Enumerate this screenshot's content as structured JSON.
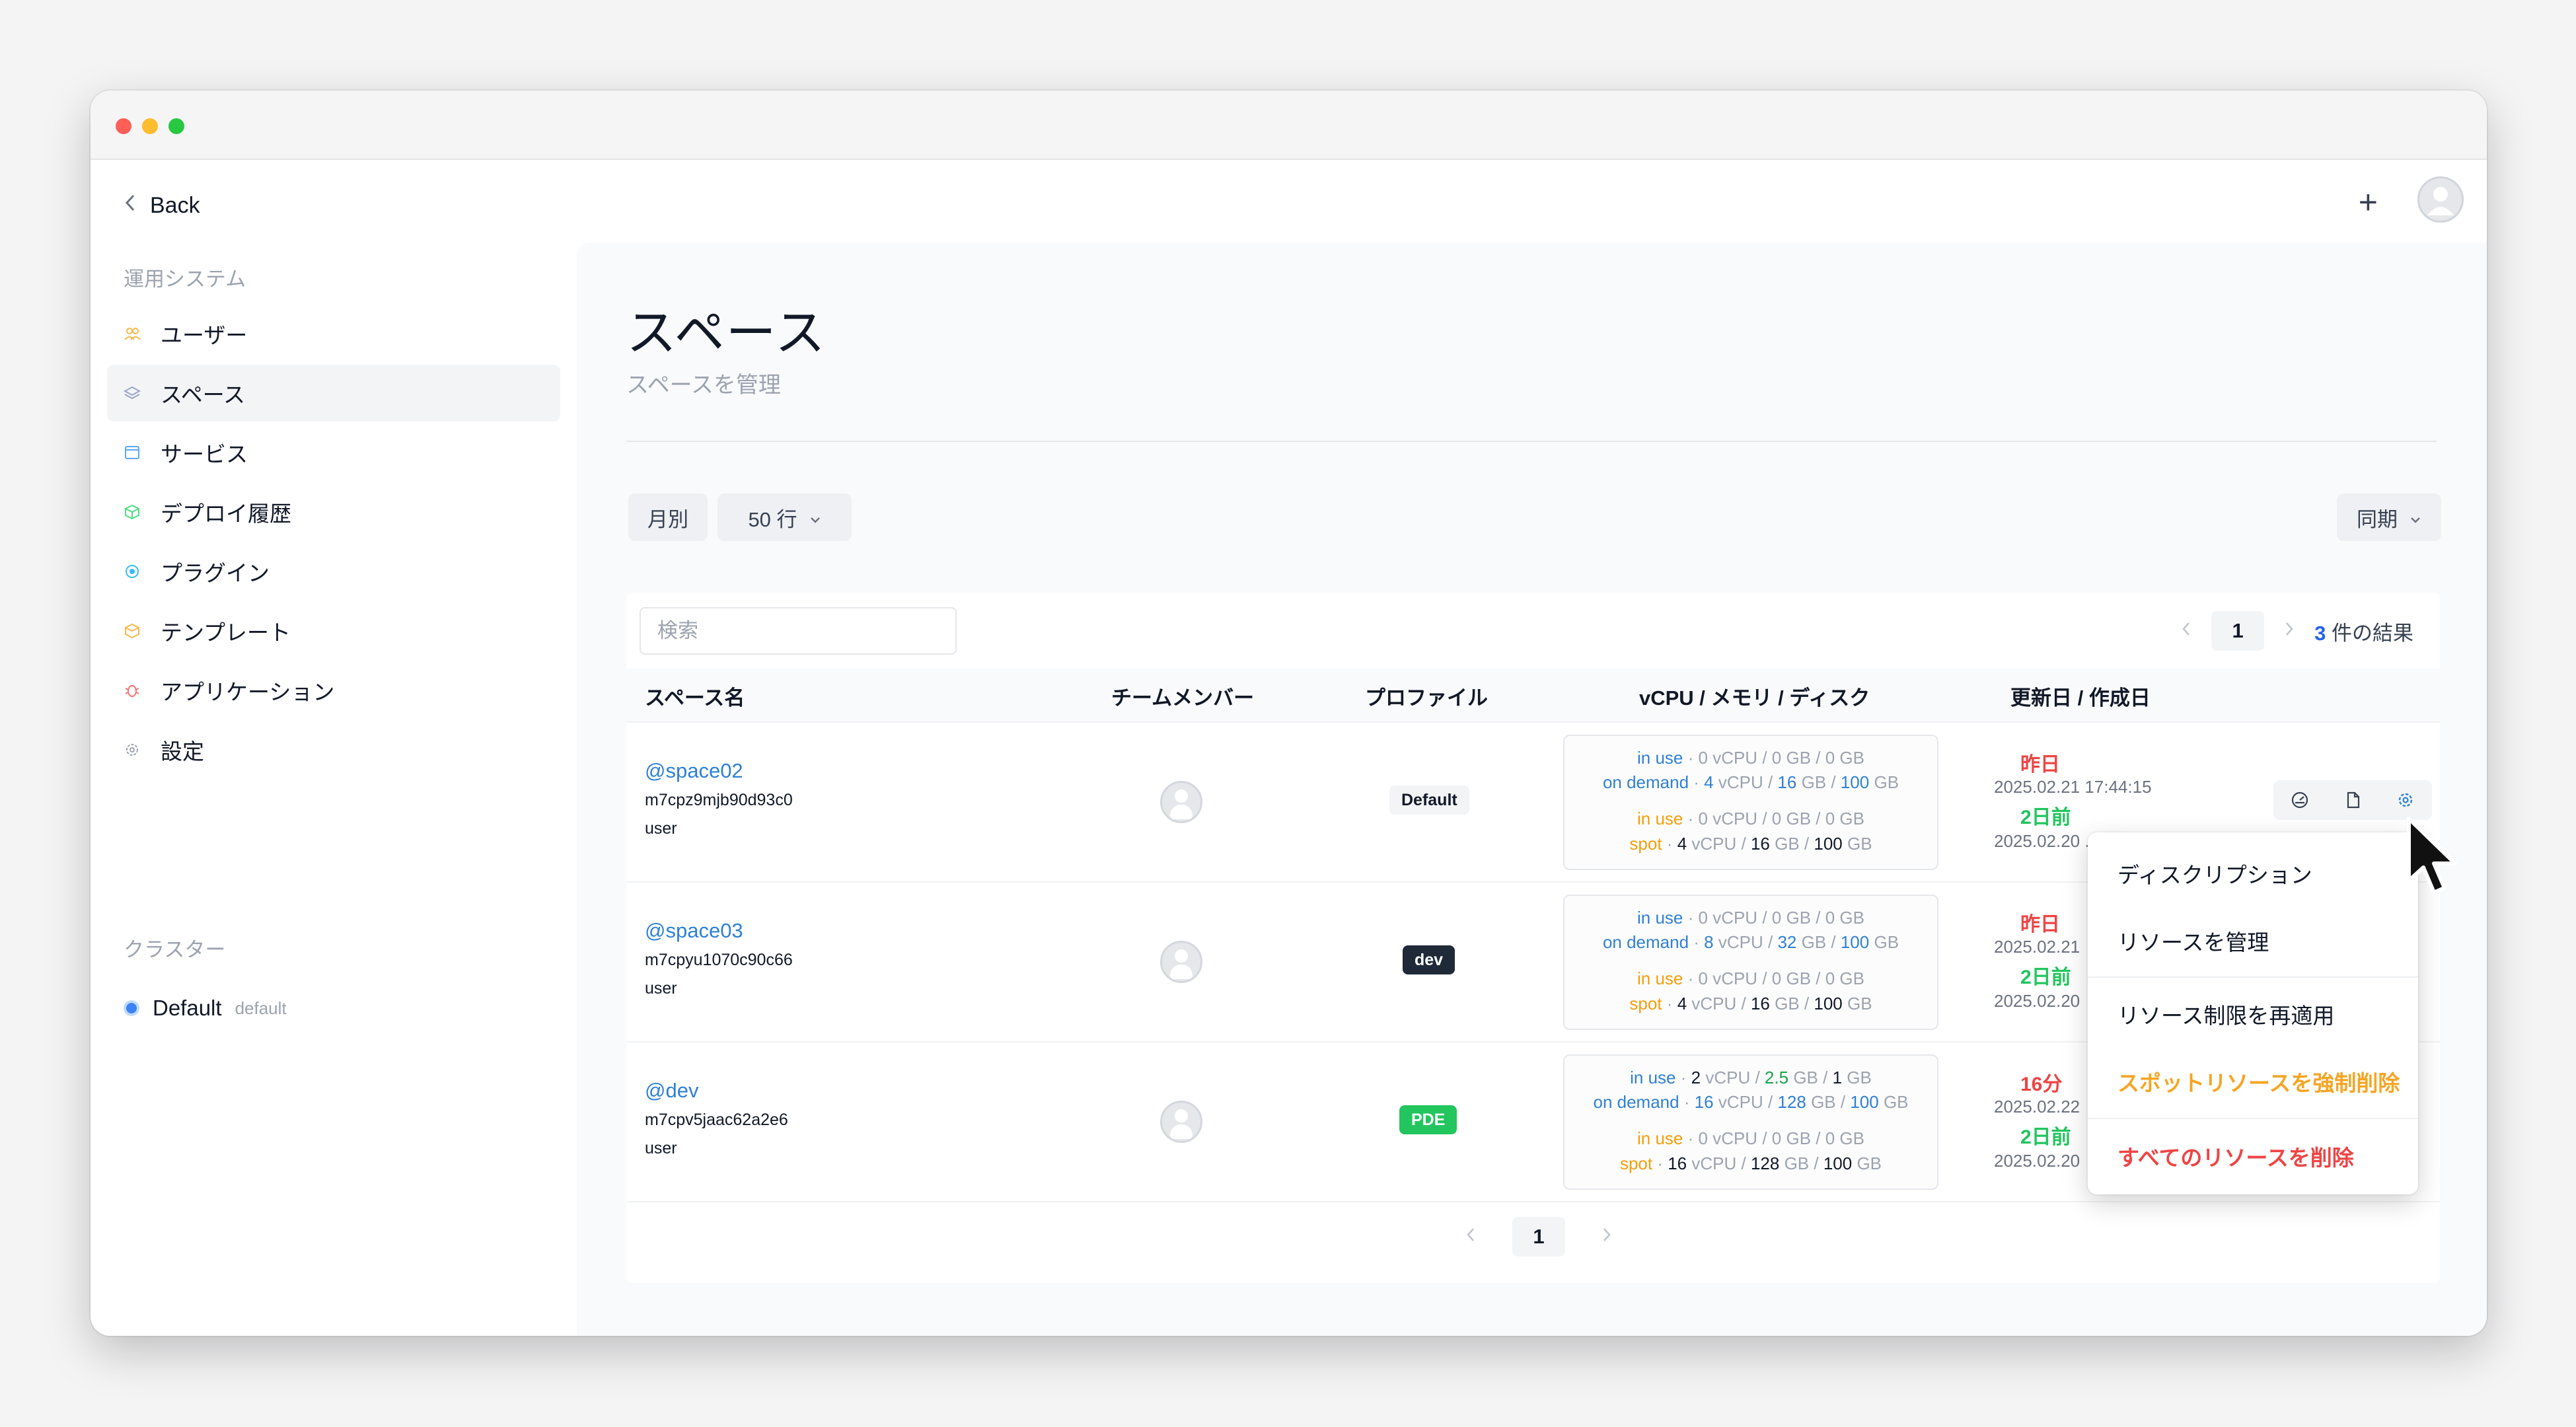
{
  "sidebar": {
    "back_label": "Back",
    "section_system": "運用システム",
    "items": [
      {
        "label": "ユーザー",
        "icon": "users-icon"
      },
      {
        "label": "スペース",
        "icon": "layers-icon"
      },
      {
        "label": "サービス",
        "icon": "window-icon"
      },
      {
        "label": "デプロイ履歴",
        "icon": "cube-icon"
      },
      {
        "label": "プラグイン",
        "icon": "plugin-icon"
      },
      {
        "label": "テンプレート",
        "icon": "box-icon"
      },
      {
        "label": "アプリケーション",
        "icon": "bug-icon"
      },
      {
        "label": "設定",
        "icon": "gear-icon"
      }
    ],
    "section_cluster": "クラスター",
    "cluster": {
      "name": "Default",
      "sub": "default"
    }
  },
  "header": {
    "plus_label": "+"
  },
  "page": {
    "title": "スペース",
    "subtitle": "スペースを管理"
  },
  "filters": {
    "monthly": "月別",
    "rows": "50 行",
    "sync": "同期"
  },
  "table": {
    "search_placeholder": "検索",
    "current_page": "1",
    "result_count": "3",
    "result_suffix": "件の結果",
    "headers": {
      "name": "スペース名",
      "members": "チームメンバー",
      "profile": "プロファイル",
      "resources": "vCPU / メモリ / ディスク",
      "dates": "更新日 / 作成日"
    },
    "rows": [
      {
        "name": "@space02",
        "id": "m7cpz9mjb90d93c0",
        "user": "user",
        "profile": "Default",
        "ondemand_inuse": {
          "label": "in use",
          "vcpu": "0",
          "mem": "0",
          "disk": "0"
        },
        "ondemand": {
          "label": "on demand",
          "vcpu": "4",
          "mem": "16",
          "disk": "100"
        },
        "spot_inuse": {
          "label": "in use",
          "vcpu": "0",
          "mem": "0",
          "disk": "0"
        },
        "spot": {
          "label": "spot",
          "vcpu": "4",
          "mem": "16",
          "disk": "100"
        },
        "updated_rel": "昨日",
        "updated_abs": "2025.02.21 17:44:15",
        "created_rel": "2日前",
        "created_abs": "2025.02.20 ..."
      },
      {
        "name": "@space03",
        "id": "m7cpyu1070c90c66",
        "user": "user",
        "profile": "dev",
        "ondemand_inuse": {
          "label": "in use",
          "vcpu": "0",
          "mem": "0",
          "disk": "0"
        },
        "ondemand": {
          "label": "on demand",
          "vcpu": "8",
          "mem": "32",
          "disk": "100"
        },
        "spot_inuse": {
          "label": "in use",
          "vcpu": "0",
          "mem": "0",
          "disk": "0"
        },
        "spot": {
          "label": "spot",
          "vcpu": "4",
          "mem": "16",
          "disk": "100"
        },
        "updated_rel": "昨日",
        "updated_abs": "2025.02.21",
        "created_rel": "2日前",
        "created_abs": "2025.02.20"
      },
      {
        "name": "@dev",
        "id": "m7cpv5jaac62a2e6",
        "user": "user",
        "profile": "PDE",
        "ondemand_inuse": {
          "label": "in use",
          "vcpu": "2",
          "mem": "2.5",
          "disk": "1"
        },
        "ondemand": {
          "label": "on demand",
          "vcpu": "16",
          "mem": "128",
          "disk": "100"
        },
        "spot_inuse": {
          "label": "in use",
          "vcpu": "0",
          "mem": "0",
          "disk": "0"
        },
        "spot": {
          "label": "spot",
          "vcpu": "16",
          "mem": "128",
          "disk": "100"
        },
        "updated_rel": "16分",
        "updated_abs": "2025.02.22",
        "created_rel": "2日前",
        "created_abs": "2025.02.20"
      }
    ],
    "units": {
      "vcpu": "vCPU",
      "gb": "GB"
    }
  },
  "dropdown": {
    "items": [
      {
        "label": "ディスクリプション",
        "variant": "normal"
      },
      {
        "label": "リソースを管理",
        "variant": "normal"
      },
      {
        "label": "リソース制限を再適用",
        "variant": "normal"
      },
      {
        "label": "スポットリソースを強制削除",
        "variant": "warn"
      },
      {
        "label": "すべてのリソースを削除",
        "variant": "danger"
      }
    ]
  },
  "colors": {
    "accent": "#2f80d6",
    "warn": "#f5a524",
    "danger": "#ef4444",
    "success": "#22c55e"
  }
}
